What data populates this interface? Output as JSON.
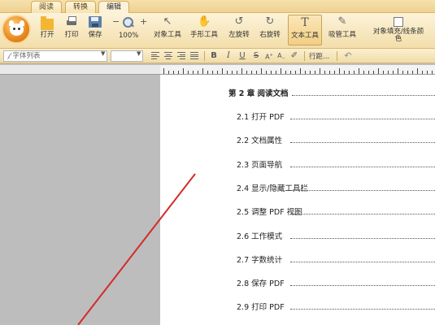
{
  "tabs": [
    {
      "label": "阅读",
      "active": false
    },
    {
      "label": "转换",
      "active": false
    },
    {
      "label": "编辑",
      "active": true
    }
  ],
  "ribbon": {
    "open": "打开",
    "print": "打印",
    "save": "保存",
    "zoom_minus": "−",
    "zoom_plus": "+",
    "zoom_level": "100%",
    "object_tool": "对象工具",
    "hand_tool": "手形工具",
    "rotate_left": "左旋转",
    "rotate_right": "右旋转",
    "text_tool": "文本工具",
    "eyedropper": "吸管工具",
    "object_fill_line1": "对象填充/线条颜",
    "object_fill_line2": "色"
  },
  "format": {
    "font_placeholder": "字体列表",
    "line_spacing": "行距..."
  },
  "document": {
    "chapter": "第 2 章  阅读文档",
    "items": [
      "2.1 打开 PDF",
      "2.2 文档属性",
      "2.3 页面导航",
      "2.4 显示/隐藏工具栏",
      "2.5 调整 PDF 视图",
      "2.6 工作模式",
      "2.7 字数统计",
      "2.8 保存 PDF",
      "2.9 打印 PDF"
    ]
  },
  "colors": {
    "accent": "#f2b632",
    "pointer": "#d42a2a"
  }
}
